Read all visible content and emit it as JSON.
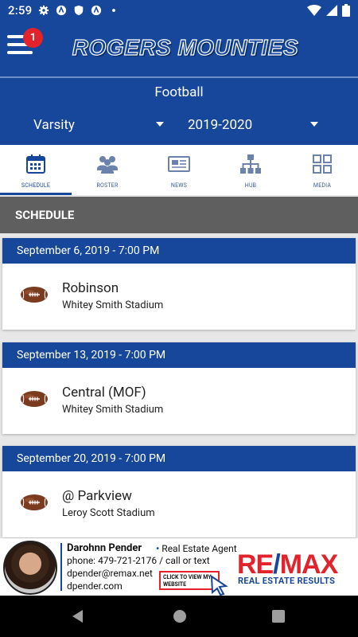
{
  "status_bar": {
    "time": "2:59",
    "icons": [
      "gear-icon",
      "app-notification-icon",
      "shield-icon",
      "app-notification-icon",
      "dot-icon"
    ],
    "right_icons": [
      "wifi-icon",
      "cellular-icon",
      "battery-icon"
    ]
  },
  "header": {
    "menu_badge": "1",
    "brand": "ROGERS MOUNTIES"
  },
  "sport": {
    "title": "Football",
    "level": "Varsity",
    "season": "2019-2020"
  },
  "tabs": [
    {
      "label": "SCHEDULE",
      "icon": "calendar-icon",
      "active": true
    },
    {
      "label": "ROSTER",
      "icon": "people-icon",
      "active": false
    },
    {
      "label": "NEWS",
      "icon": "newspaper-icon",
      "active": false
    },
    {
      "label": "HUB",
      "icon": "org-chart-icon",
      "active": false
    },
    {
      "label": "MEDIA",
      "icon": "grid-icon",
      "active": false
    }
  ],
  "section": {
    "title": "SCHEDULE"
  },
  "games": [
    {
      "date": "September 6, 2019 - 7:00 PM",
      "opponent": "Robinson",
      "venue": "Whitey Smith Stadium"
    },
    {
      "date": "September 13, 2019 - 7:00 PM",
      "opponent": "Central (MOF)",
      "venue": "Whitey Smith Stadium"
    },
    {
      "date": "September 20, 2019 - 7:00 PM",
      "opponent": "@ Parkview",
      "venue": "Leroy Scott Stadium"
    }
  ],
  "ad": {
    "name": "Darohnn Pender",
    "title": "Real Estate Agent",
    "phone_line": "phone: 479-721-2176 / call or text",
    "email": "dpender@remax.net",
    "website": "dpender.com",
    "cta": "CLICK TO VIEW MY WEBSITE",
    "logo_left": "RE",
    "logo_slash": "/",
    "logo_right": "MAX",
    "tagline": "REAL ESTATE RESULTS"
  },
  "colors": {
    "primary": "#16479a",
    "section_header": "#5f5f5f",
    "badge": "#e2232c",
    "background": "#e7e7e7"
  }
}
